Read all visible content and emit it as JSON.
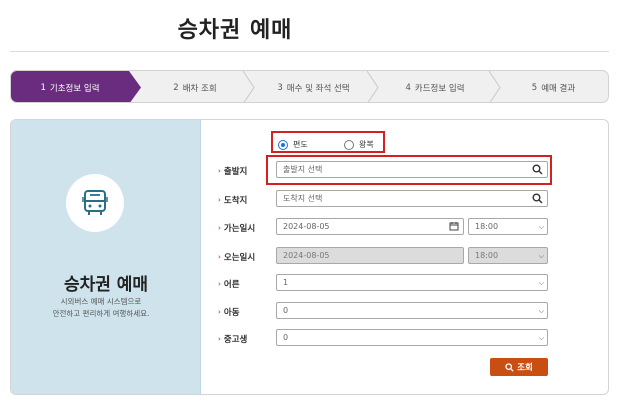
{
  "page": {
    "title": "승차권 예매"
  },
  "steps": [
    {
      "num": "1",
      "label": "기초정보 입력",
      "active": true
    },
    {
      "num": "2",
      "label": "배차 조회",
      "active": false
    },
    {
      "num": "3",
      "label": "매수 및 좌석 선택",
      "active": false
    },
    {
      "num": "4",
      "label": "카드정보 입력",
      "active": false
    },
    {
      "num": "5",
      "label": "예매 결과",
      "active": false
    }
  ],
  "intro": {
    "icon": "bus-icon",
    "title": "승차권 예매",
    "desc_line1": "시외버스 예매 시스템으로",
    "desc_line2": "안전하고 편리하게 여행하세요."
  },
  "trip_type": {
    "one_way": "편도",
    "round_trip": "왕복",
    "selected": "편도"
  },
  "form": {
    "departure": {
      "label": "출발지",
      "placeholder": "출발지 선택"
    },
    "arrival": {
      "label": "도착지",
      "placeholder": "도착지 선택"
    },
    "go_date": {
      "label": "가는일시",
      "date": "2024-08-05",
      "time": "18:00"
    },
    "return_date": {
      "label": "오는일시",
      "date": "2024-08-05",
      "time": "18:00"
    },
    "adult": {
      "label": "어른",
      "value": "1"
    },
    "child": {
      "label": "아동",
      "value": "0"
    },
    "student": {
      "label": "중고생",
      "value": "0"
    }
  },
  "search_button": "조회",
  "colors": {
    "accent": "#6a2c7e",
    "button": "#c94e12",
    "highlight": "#d42020",
    "panel": "#cfe3ec"
  }
}
